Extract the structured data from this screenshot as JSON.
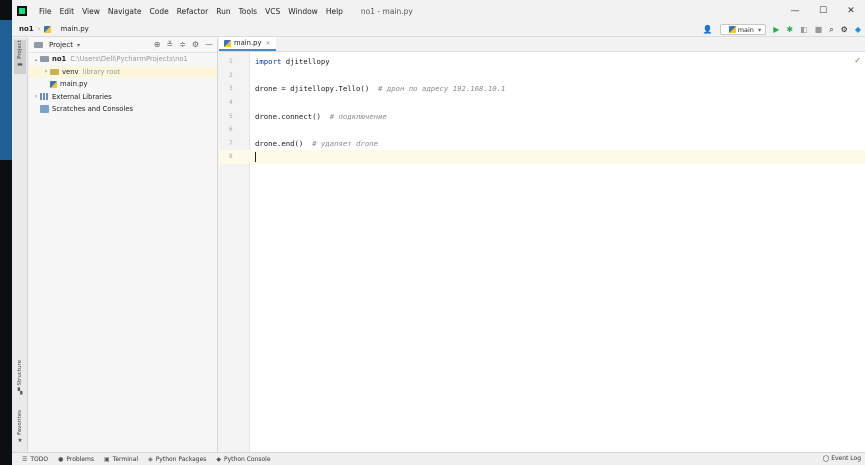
{
  "window": {
    "title": "no1 - main.py",
    "menu": [
      "File",
      "Edit",
      "View",
      "Navigate",
      "Code",
      "Refactor",
      "Run",
      "Tools",
      "VCS",
      "Window",
      "Help"
    ],
    "controls": [
      "—",
      "☐",
      "✕"
    ]
  },
  "breadcrumb": {
    "project": "no1",
    "file": "main.py"
  },
  "toolbar": {
    "run_config": "main",
    "run_config_arrow": "▾"
  },
  "side_tabs": {
    "project": "Project",
    "structure": "Structure",
    "favorites": "Favorites"
  },
  "project_panel": {
    "title": "Project",
    "tree": {
      "root_name": "no1",
      "root_path": "C:\\Users\\Dell\\PycharmProjects\\no1",
      "venv_name": "venv",
      "venv_note": "library root",
      "file": "main.py",
      "external": "External Libraries",
      "scratches": "Scratches and Consoles"
    }
  },
  "editor": {
    "tab_label": "main.py",
    "line_numbers": [
      "1",
      "2",
      "3",
      "4",
      "5",
      "6",
      "7",
      "8"
    ],
    "lines": {
      "l1_kw": "import",
      "l1_rest": " djitellopy",
      "l3_code": "drone = djitellopy.Tello()  ",
      "l3_comment": "# дрон по адресу 192.168.10.1",
      "l5_code": "drone.connect()  ",
      "l5_comment": "# подключение",
      "l7_code": "drone.end()  ",
      "l7_comment": "# удаляет drone"
    }
  },
  "bottom_tabs": {
    "todo": "TODO",
    "problems": "Problems",
    "terminal": "Terminal",
    "packages": "Python Packages",
    "console": "Python Console",
    "event_log": "Event Log"
  }
}
